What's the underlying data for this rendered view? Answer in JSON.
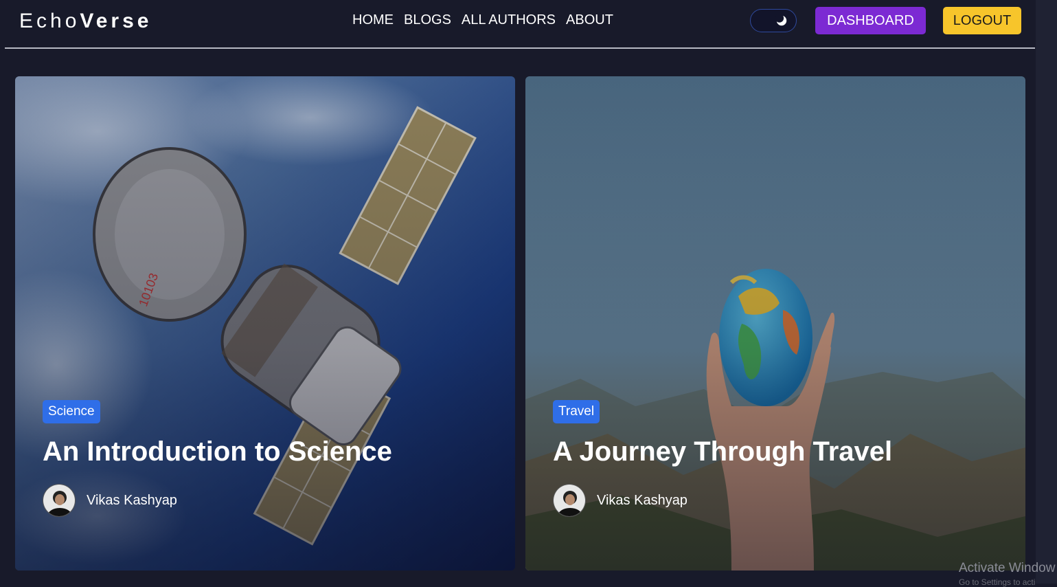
{
  "brand": {
    "logo_light": "Echo",
    "logo_bold": "Verse"
  },
  "nav": {
    "items": [
      {
        "label": "HOME"
      },
      {
        "label": "BLOGS"
      },
      {
        "label": "ALL AUTHORS"
      },
      {
        "label": "ABOUT"
      }
    ],
    "theme_toggle_icon": "moon-icon",
    "dashboard_label": "DASHBOARD",
    "logout_label": "LOGOUT"
  },
  "colors": {
    "background": "#181a2a",
    "dashboard_button": "#7c2ad3",
    "logout_button": "#f7c52b",
    "category_badge": "#2f6ee8",
    "divider": "#b8bac4"
  },
  "posts": [
    {
      "category": "Science",
      "title": "An Introduction to Science",
      "author": "Vikas Kashyap",
      "image": "spacecraft-over-earth"
    },
    {
      "category": "Travel",
      "title": "A Journey Through Travel",
      "author": "Vikas Kashyap",
      "image": "hand-holding-globe"
    }
  ],
  "os_watermark": {
    "line1": "Activate Window",
    "line2": "Go to Settings to acti"
  }
}
